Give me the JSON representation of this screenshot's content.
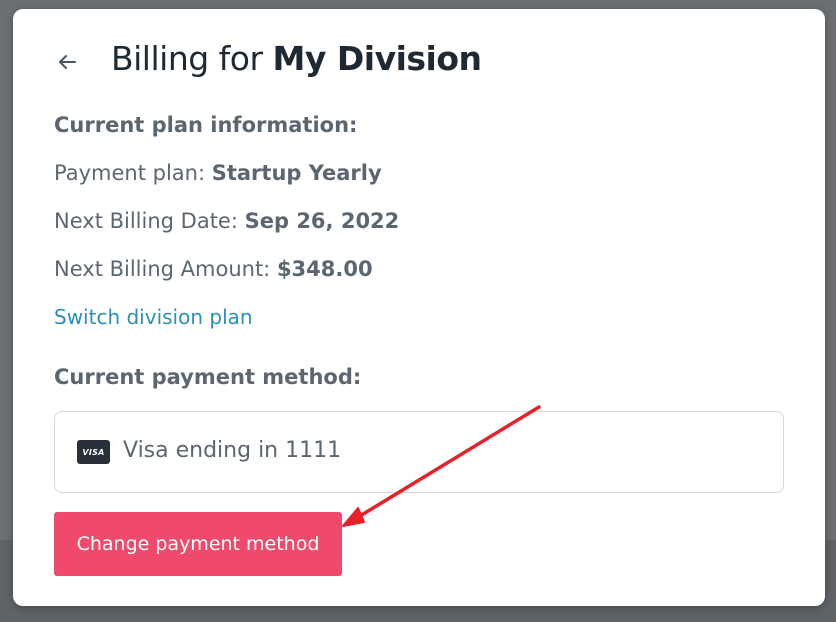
{
  "header": {
    "back_icon": "arrow-left-icon",
    "title_prefix": "Billing for ",
    "title_division": "My Division"
  },
  "plan": {
    "heading": "Current plan information:",
    "payment_plan_label": "Payment plan: ",
    "payment_plan_value": "Startup Yearly",
    "next_billing_date_label": "Next Billing Date: ",
    "next_billing_date_value": "Sep 26, 2022",
    "next_billing_amount_label": "Next Billing Amount: ",
    "next_billing_amount_value": "$348.00",
    "switch_link": "Switch division plan"
  },
  "payment": {
    "heading": "Current payment method:",
    "card_brand_badge": "VISA",
    "card_icon": "visa-card-icon",
    "card_text": "Visa ending in 1111",
    "change_button": "Change payment method"
  },
  "colors": {
    "accent_button": "#ef4a6c",
    "link": "#2b8fb8",
    "annotation_arrow": "#e8202a"
  }
}
